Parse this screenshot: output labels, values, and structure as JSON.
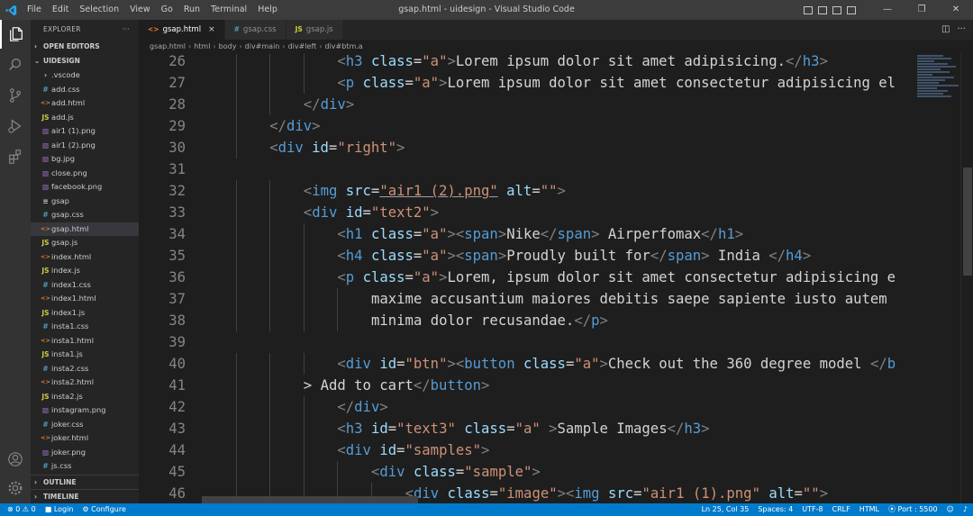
{
  "window": {
    "title": "gsap.html - uidesign - Visual Studio Code",
    "menu": [
      "File",
      "Edit",
      "Selection",
      "View",
      "Go",
      "Run",
      "Terminal",
      "Help"
    ]
  },
  "sidebar": {
    "header": "EXPLORER",
    "open_editors": "OPEN EDITORS",
    "project": "UIDESIGN",
    "files": [
      {
        "name": ".vscode",
        "type": "folder"
      },
      {
        "name": "add.css",
        "type": "css"
      },
      {
        "name": "add.html",
        "type": "html"
      },
      {
        "name": "add.js",
        "type": "js"
      },
      {
        "name": "air1 (1).png",
        "type": "img"
      },
      {
        "name": "air1 (2).png",
        "type": "img"
      },
      {
        "name": "bg.jpg",
        "type": "img"
      },
      {
        "name": "close.png",
        "type": "img"
      },
      {
        "name": "facebook.png",
        "type": "img"
      },
      {
        "name": "gsap",
        "type": "plain"
      },
      {
        "name": "gsap.css",
        "type": "css"
      },
      {
        "name": "gsap.html",
        "type": "html"
      },
      {
        "name": "gsap.js",
        "type": "js"
      },
      {
        "name": "index.html",
        "type": "html"
      },
      {
        "name": "index.js",
        "type": "js"
      },
      {
        "name": "index1.css",
        "type": "css"
      },
      {
        "name": "index1.html",
        "type": "html"
      },
      {
        "name": "index1.js",
        "type": "js"
      },
      {
        "name": "insta1.css",
        "type": "css"
      },
      {
        "name": "insta1.html",
        "type": "html"
      },
      {
        "name": "insta1.js",
        "type": "js"
      },
      {
        "name": "insta2.css",
        "type": "css"
      },
      {
        "name": "insta2.html",
        "type": "html"
      },
      {
        "name": "insta2.js",
        "type": "js"
      },
      {
        "name": "instagram.png",
        "type": "img"
      },
      {
        "name": "joker.css",
        "type": "css"
      },
      {
        "name": "joker.html",
        "type": "html"
      },
      {
        "name": "joker.png",
        "type": "img"
      },
      {
        "name": "js.css",
        "type": "css"
      }
    ],
    "outline": "OUTLINE",
    "timeline": "TIMELINE"
  },
  "tabs": [
    {
      "label": "gsap.html",
      "type": "html"
    },
    {
      "label": "gsap.css",
      "type": "css"
    },
    {
      "label": "gsap.js",
      "type": "js"
    }
  ],
  "breadcrumb": [
    "gsap.html",
    "html",
    "body",
    "div#main",
    "div#left",
    "div#btm.a"
  ],
  "editor": {
    "lines": [
      {
        "n": 26,
        "indent": 4,
        "html": "<span class=p>&lt;</span><span class=t>h3</span> <span class=a>class</span>=<span class=s>\"a\"</span><span class=p>&gt;</span>Lorem ipsum dolor sit amet adipisicing.<span class=p>&lt;/</span><span class=t>h3</span><span class=p>&gt;</span>"
      },
      {
        "n": 27,
        "indent": 4,
        "html": "<span class=p>&lt;</span><span class=t>p</span> <span class=a>class</span>=<span class=s>\"a\"</span><span class=p>&gt;</span>Lorem ipsum dolor sit amet consectetur adipisicing el"
      },
      {
        "n": 28,
        "indent": 3,
        "html": "<span class=p>&lt;/</span><span class=t>div</span><span class=p>&gt;</span>"
      },
      {
        "n": 29,
        "indent": 2,
        "html": "<span class=p>&lt;/</span><span class=t>div</span><span class=p>&gt;</span>"
      },
      {
        "n": 30,
        "indent": 2,
        "html": "<span class=p>&lt;</span><span class=t>div</span> <span class=a>id</span>=<span class=s>\"right\"</span><span class=p>&gt;</span>"
      },
      {
        "n": 31,
        "indent": 0,
        "html": ""
      },
      {
        "n": 32,
        "indent": 3,
        "html": "<span class=p>&lt;</span><span class=t>img</span> <span class=a>src</span>=<span class=\"s u\">\"air1 (2).png\"</span> <span class=a>alt</span>=<span class=s>\"\"</span><span class=p>&gt;</span>"
      },
      {
        "n": 33,
        "indent": 3,
        "html": "<span class=p>&lt;</span><span class=t>div</span> <span class=a>id</span>=<span class=s>\"text2\"</span><span class=p>&gt;</span>"
      },
      {
        "n": 34,
        "indent": 4,
        "html": "<span class=p>&lt;</span><span class=t>h1</span> <span class=a>class</span>=<span class=s>\"a\"</span><span class=p>&gt;&lt;</span><span class=t>span</span><span class=p>&gt;</span>Nike<span class=p>&lt;/</span><span class=t>span</span><span class=p>&gt;</span> Airperfomax<span class=p>&lt;/</span><span class=t>h1</span><span class=p>&gt;</span>"
      },
      {
        "n": 35,
        "indent": 4,
        "html": "<span class=p>&lt;</span><span class=t>h4</span> <span class=a>class</span>=<span class=s>\"a\"</span><span class=p>&gt;&lt;</span><span class=t>span</span><span class=p>&gt;</span>Proudly built for<span class=p>&lt;/</span><span class=t>span</span><span class=p>&gt;</span> India <span class=p>&lt;/</span><span class=t>h4</span><span class=p>&gt;</span>"
      },
      {
        "n": 36,
        "indent": 4,
        "html": "<span class=p>&lt;</span><span class=t>p</span> <span class=a>class</span>=<span class=s>\"a\"</span><span class=p>&gt;</span>Lorem, ipsum dolor sit amet consectetur adipisicing e"
      },
      {
        "n": 37,
        "indent": 5,
        "html": "maxime accusantium maiores debitis saepe sapiente iusto autem"
      },
      {
        "n": 38,
        "indent": 5,
        "html": "minima dolor recusandae.<span class=p>&lt;/</span><span class=t>p</span><span class=p>&gt;</span>"
      },
      {
        "n": 39,
        "indent": 0,
        "html": ""
      },
      {
        "n": 40,
        "indent": 4,
        "html": "<span class=p>&lt;</span><span class=t>div</span> <span class=a>id</span>=<span class=s>\"btn\"</span><span class=p>&gt;&lt;</span><span class=t>button</span> <span class=a>class</span>=<span class=s>\"a\"</span><span class=p>&gt;</span>Check out the 360 degree model <span class=p>&lt;/</span><span class=t>b</span>"
      },
      {
        "n": 41,
        "indent": 3,
        "html": "&gt; Add to cart<span class=p>&lt;/</span><span class=t>button</span><span class=p>&gt;</span>"
      },
      {
        "n": 42,
        "indent": 4,
        "html": "<span class=p>&lt;/</span><span class=t>div</span><span class=p>&gt;</span>"
      },
      {
        "n": 43,
        "indent": 4,
        "html": "<span class=p>&lt;</span><span class=t>h3</span> <span class=a>id</span>=<span class=s>\"text3\"</span> <span class=a>class</span>=<span class=s>\"a\"</span> <span class=p>&gt;</span>Sample Images<span class=p>&lt;/</span><span class=t>h3</span><span class=p>&gt;</span>"
      },
      {
        "n": 44,
        "indent": 4,
        "html": "<span class=p>&lt;</span><span class=t>div</span> <span class=a>id</span>=<span class=s>\"samples\"</span><span class=p>&gt;</span>"
      },
      {
        "n": 45,
        "indent": 5,
        "html": "<span class=p>&lt;</span><span class=t>div</span> <span class=a>class</span>=<span class=s>\"sample\"</span><span class=p>&gt;</span>"
      },
      {
        "n": 46,
        "indent": 6,
        "html": "<span class=p>&lt;</span><span class=t>div</span> <span class=a>class</span>=<span class=s>\"image\"</span><span class=p>&gt;&lt;</span><span class=t>img</span> <span class=a>src</span>=<span class=s>\"air1 (1).png\"</span> <span class=a>alt</span>=<span class=s>\"\"</span><span class=p>&gt;</span>"
      }
    ]
  },
  "statusbar": {
    "errors": "0",
    "warnings": "0",
    "login": "Login",
    "configure": "Configure",
    "position": "Ln 25, Col 35",
    "spaces": "Spaces: 4",
    "encoding": "UTF-8",
    "eol": "CRLF",
    "language": "HTML",
    "port": "Port : 5500"
  },
  "colors": {
    "accent": "#007acc",
    "tag": "#569cd6",
    "attr": "#9cdcfe",
    "string": "#ce9178",
    "html_icon": "#e37933",
    "css_icon": "#519aba",
    "js_icon": "#cbcb41",
    "img_icon": "#a074c4"
  }
}
